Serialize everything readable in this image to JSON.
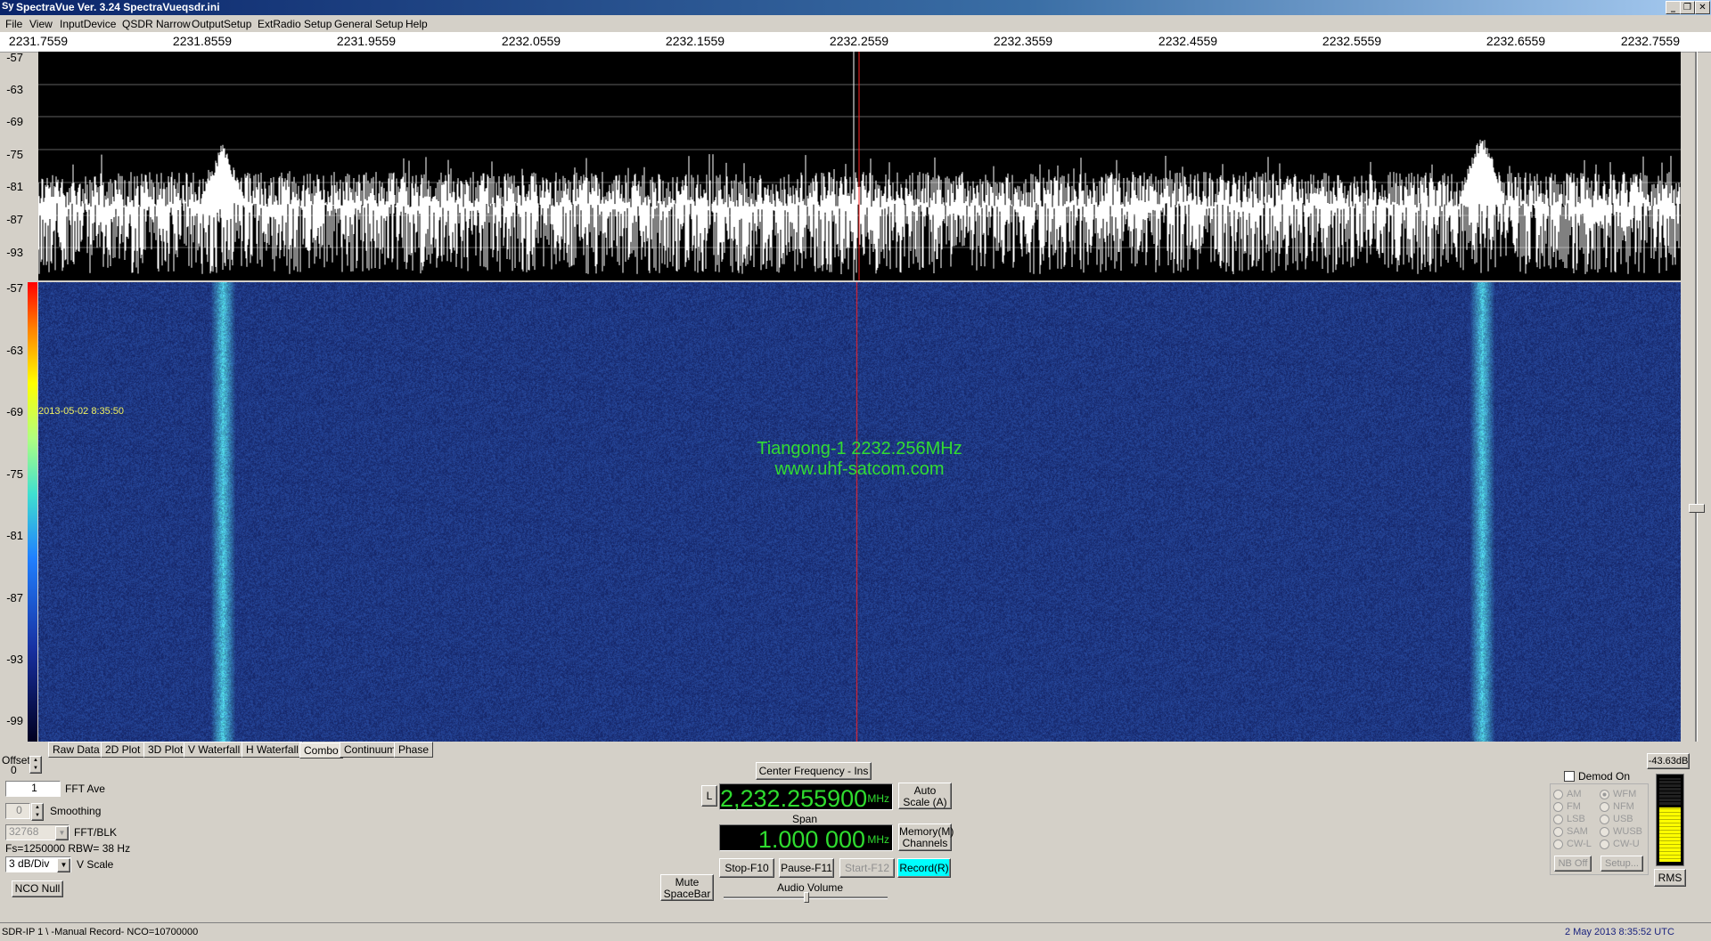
{
  "window": {
    "title": "SpectraVue Ver. 3.24  SpectraVueqsdr.ini",
    "app_icon": "Sy"
  },
  "menu": [
    "File",
    "View",
    "InputDevice",
    "QSDR Narrow",
    "OutputSetup",
    "ExtRadio Setup",
    "General Setup",
    "Help"
  ],
  "freq_axis": [
    "2231.7559",
    "2231.8559",
    "2231.9559",
    "2232.0559",
    "2232.1559",
    "2232.2559",
    "2232.3559",
    "2232.4559",
    "2232.5559",
    "2232.6559",
    "2232.7559"
  ],
  "spectrum_y_labels": [
    "-57",
    "-63",
    "-69",
    "-75",
    "-81",
    "-87",
    "-93"
  ],
  "waterfall_y_labels": [
    "-57",
    "-63",
    "-69",
    "-75",
    "-81",
    "-87",
    "-93",
    "-99"
  ],
  "waterfall": {
    "timestamp": "2013-05-02 8:35:50",
    "overlay_line1": "Tiangong-1 2232.256MHz",
    "overlay_line2": "www.uhf-satcom.com"
  },
  "tabs": [
    "Raw Data",
    "2D Plot",
    "3D Plot",
    "V Waterfall",
    "H Waterfall",
    "Combo",
    "Continuum",
    "Phase"
  ],
  "active_tab": "Combo",
  "left_panel": {
    "offset_label": "Offset",
    "offset_value": "0",
    "fft_ave_value": "1",
    "fft_ave_label": "FFT Ave",
    "smoothing_value": "0",
    "smoothing_label": "Smoothing",
    "fft_blk_value": "32768",
    "fft_blk_label": "FFT/BLK",
    "fs_info": "Fs=1250000 RBW=  38 Hz",
    "vscale_value": "3 dB/Div",
    "vscale_label": "V Scale",
    "nco_null": "NCO Null"
  },
  "center_panel": {
    "center_freq_btn": "Center Frequency - Ins",
    "l_btn": "L",
    "freq_value": "2,232.255900",
    "freq_unit": "MHz",
    "auto_scale": "Auto Scale (A)",
    "span_label": "Span",
    "span_value": "1.000 000",
    "span_unit": "MHz",
    "memory": "Memory(M) Channels",
    "mute": "Mute SpaceBar",
    "stop": "Stop-F10",
    "pause": "Pause-F11",
    "start": "Start-F12",
    "record": "Record(R)",
    "audio_volume": "Audio Volume",
    "audio_volume_level": 0.5
  },
  "right_panel": {
    "level": "-43.63dB",
    "level_fill": 0.6,
    "demod_on": "Demod On",
    "modes_left": [
      "AM",
      "FM",
      "LSB",
      "SAM",
      "CW-L"
    ],
    "modes_right": [
      "WFM",
      "NFM",
      "USB",
      "WUSB",
      "CW-U"
    ],
    "selected_mode": "WFM",
    "nb_off": "NB Off",
    "setup": "Setup...",
    "rms": "RMS"
  },
  "status": {
    "left": "SDR-IP 1  \\ -Manual Record-   NCO=10700000",
    "right": "2 May 2013  8:35:52 UTC"
  },
  "colors": {
    "record_button": "#00ffff",
    "lcd_text": "#2fdc2f",
    "overlay_text": "#32dc32",
    "waterfall_bg": "#1b2a72",
    "signal_marker": "#ff2020"
  }
}
